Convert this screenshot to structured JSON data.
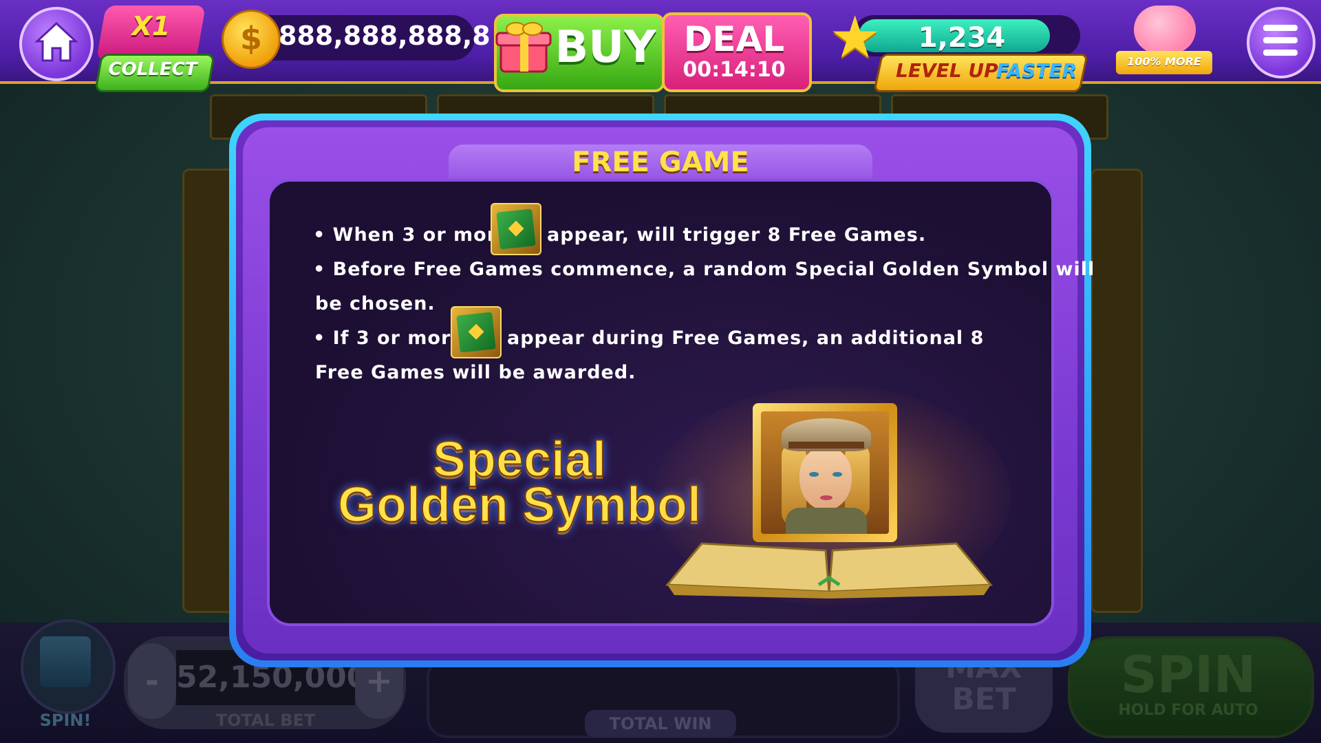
{
  "topbar": {
    "multiplier": "X1",
    "collect_label": "COLLECT",
    "coins": "888,888,888,8",
    "buy_label": "BUY",
    "deal_label": "DEAL",
    "deal_timer": "00:14:10",
    "level_value": "1,234",
    "level_up_label": "LEVEL UP",
    "faster_label": "FASTER",
    "piggy_label": "100% MORE"
  },
  "modal": {
    "title": "FREE GAME",
    "rules": {
      "r1_pre": "• When 3 or more",
      "r1_post": "appear, will trigger 8 Free Games.",
      "r2_a": "• Before Free Games commence, a random Special Golden Symbol will",
      "r2_b": "be chosen.",
      "r3_pre": "• If 3 or more",
      "r3_post": "appear during Free Games, an additional 8",
      "r3_b": "Free Games will be awarded."
    },
    "special_line1": "Special",
    "special_line2": "Golden Symbol"
  },
  "bottom": {
    "gift_label": "SPIN!",
    "minus_label": "-",
    "plus_label": "+",
    "total_bet_value": "52,150,000",
    "total_bet_label": "TOTAL BET",
    "total_win_label": "TOTAL WIN",
    "maxbet_line1": "MAX",
    "maxbet_line2": "BET",
    "spin_label": "SPIN",
    "spin_sub": "HOLD FOR AUTO"
  },
  "icons": {
    "home": "home-icon",
    "coin": "dollar-coin-icon",
    "gift": "gift-icon",
    "star": "star-icon",
    "piggy": "piggy-bank-icon",
    "menu": "hamburger-menu-icon",
    "book": "book-scatter-symbol-icon"
  },
  "colors": {
    "topbar": "#5a25b6",
    "modal_border": "#3fd6ff",
    "title_text": "#ffe24a",
    "buy_green": "#5cd02a",
    "deal_pink": "#ff4aa3"
  }
}
